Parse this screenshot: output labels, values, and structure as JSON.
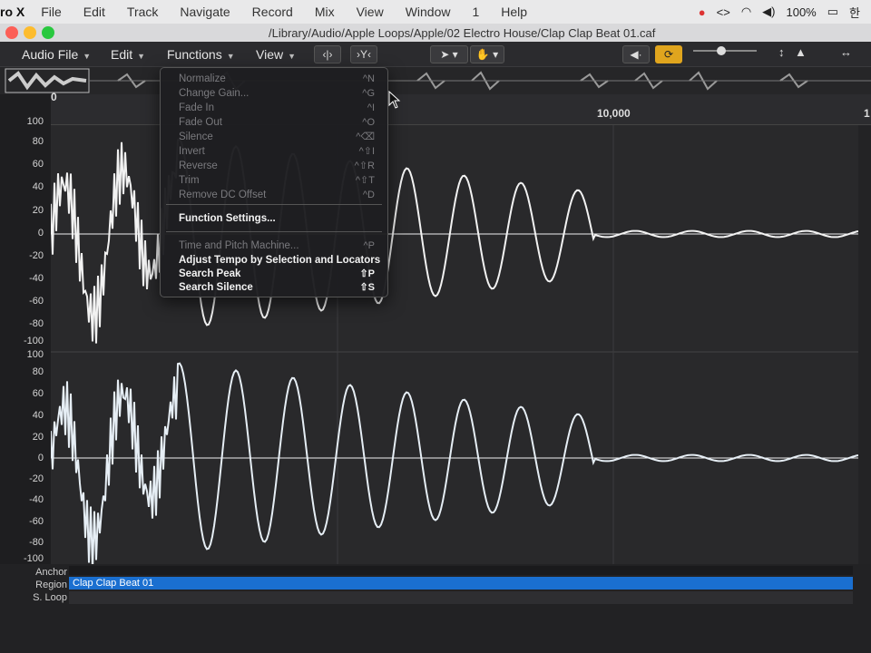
{
  "menubar": {
    "app_name": "ro X",
    "items": [
      "File",
      "Edit",
      "Track",
      "Navigate",
      "Record",
      "Mix",
      "View",
      "Window",
      "1",
      "Help"
    ],
    "battery": "100%",
    "input_source": "한"
  },
  "window": {
    "title": "/Library/Audio/Apple Loops/Apple/02 Electro House/Clap Clap Beat 01.caf"
  },
  "toolbar": {
    "menus": [
      "Audio File",
      "Edit",
      "Functions",
      "View"
    ]
  },
  "ruler": {
    "labels": [
      "0",
      "10,000",
      "1"
    ]
  },
  "channel_top": {
    "axis": [
      "100",
      "80",
      "60",
      "40",
      "20",
      "0",
      "-20",
      "-40",
      "-60",
      "-80",
      "-100"
    ]
  },
  "channel_bottom": {
    "axis": [
      "100",
      "80",
      "60",
      "40",
      "20",
      "0",
      "-20",
      "-40",
      "-60",
      "-80",
      "-100"
    ]
  },
  "functions_menu": {
    "items": [
      {
        "label": "Normalize",
        "shortcut": "^N",
        "enabled": false
      },
      {
        "label": "Change Gain...",
        "shortcut": "^G",
        "enabled": false
      },
      {
        "label": "Fade In",
        "shortcut": "^I",
        "enabled": false
      },
      {
        "label": "Fade Out",
        "shortcut": "^O",
        "enabled": false
      },
      {
        "label": "Silence",
        "shortcut": "^⌫",
        "enabled": false
      },
      {
        "label": "Invert",
        "shortcut": "^⇧I",
        "enabled": false
      },
      {
        "label": "Reverse",
        "shortcut": "^⇧R",
        "enabled": false
      },
      {
        "label": "Trim",
        "shortcut": "^⇧T",
        "enabled": false
      },
      {
        "label": "Remove DC Offset",
        "shortcut": "^D",
        "enabled": false
      },
      {
        "label": "Function Settings...",
        "shortcut": "",
        "enabled": true
      },
      {
        "label": "Time and Pitch Machine...",
        "shortcut": "^P",
        "enabled": false
      },
      {
        "label": "Adjust Tempo by Selection and Locators",
        "shortcut": "",
        "enabled": true
      },
      {
        "label": "Search Peak",
        "shortcut": "⇧P",
        "enabled": true
      },
      {
        "label": "Search Silence",
        "shortcut": "⇧S",
        "enabled": true
      }
    ]
  },
  "bottom": {
    "anchor_label": "Anchor",
    "region_label": "Region",
    "loop_label": "S. Loop",
    "region_name": "Clap Clap Beat 01"
  },
  "icons": {
    "cursor": "pointer-arrow-icon",
    "loop_active": "cycle-icon",
    "accent_color": "#e0a51e",
    "region_color": "#1a6fd0"
  }
}
